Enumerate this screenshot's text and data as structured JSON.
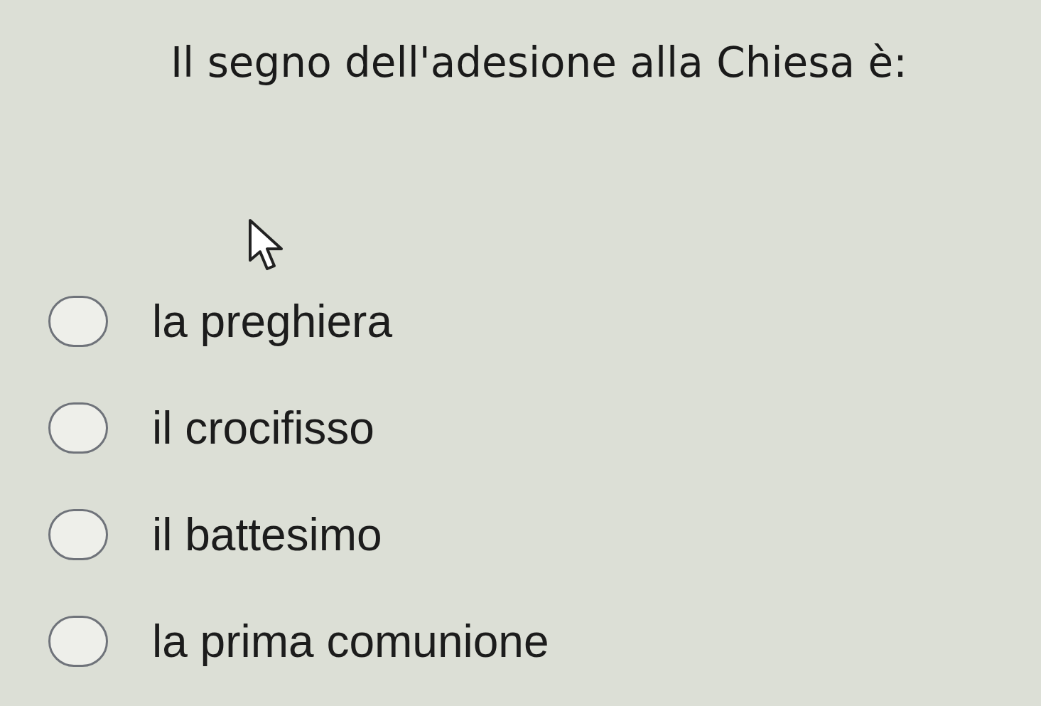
{
  "question": "Il segno dell'adesione alla Chiesa è:",
  "options": [
    {
      "label": "la preghiera",
      "selected": false
    },
    {
      "label": "il crocifisso",
      "selected": false
    },
    {
      "label": "il battesimo",
      "selected": false
    },
    {
      "label": "la prima comunione",
      "selected": false
    }
  ]
}
